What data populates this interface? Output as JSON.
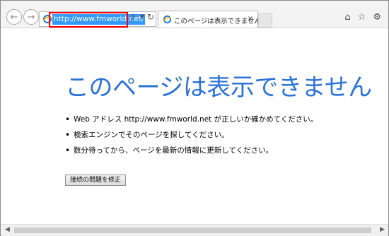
{
  "browser": {
    "back_icon": "arrow-left-icon",
    "forward_icon": "arrow-right-icon",
    "address": {
      "url": "http://www.fmworld.net/"
    },
    "tab": {
      "title": "このページは表示できません",
      "close": "×"
    },
    "highlight_color": "#ff0000",
    "icons": [
      "home-icon",
      "star-icon",
      "gear-icon"
    ]
  },
  "page": {
    "heading": "このページは表示できません",
    "heading_color": "#2b73d6",
    "bullets": [
      "Web アドレス http://www.fmworld.net が正しいか確かめてください。",
      "検索エンジンでそのページを探してください。",
      "数分待ってから、ページを最新の情報に更新してください。"
    ],
    "fix_button": "接続の問題を修正"
  }
}
